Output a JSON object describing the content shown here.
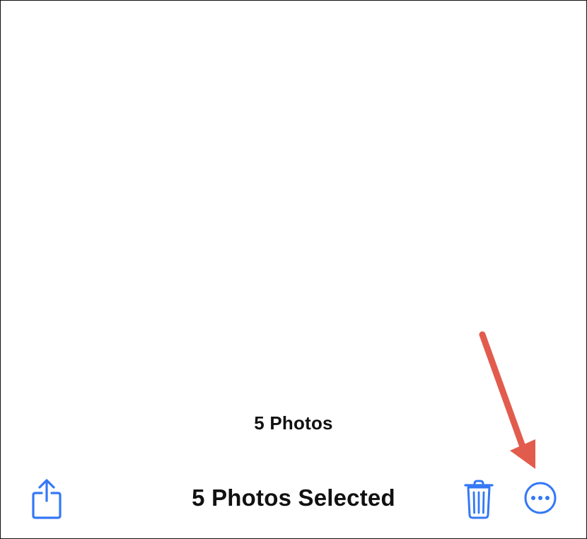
{
  "photos": {
    "count_label": "5 Photos"
  },
  "toolbar": {
    "title": "5 Photos Selected",
    "icons": {
      "share": "share-icon",
      "trash": "trash-icon",
      "more": "ellipsis-circle-icon"
    }
  },
  "colors": {
    "accent": "#3478F6",
    "annotation": "#E25C4D",
    "text": "#111111",
    "background": "#FFFFFF"
  }
}
